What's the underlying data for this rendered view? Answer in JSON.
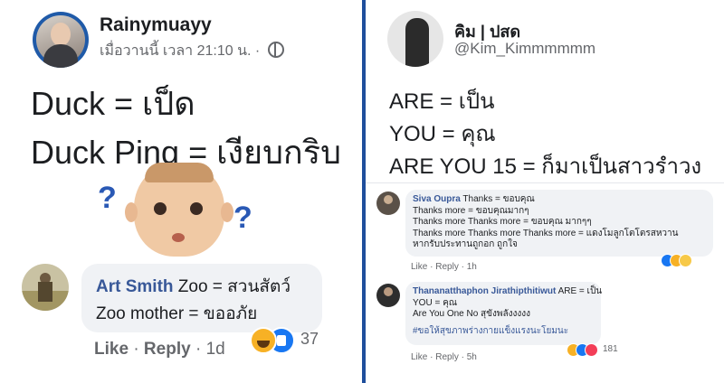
{
  "left_post": {
    "author": "Rainymuayy",
    "time": "เมื่อวานนี้ เวลา 21:10 น. ·",
    "line1": "Duck = เป็ด",
    "line2": "Duck Ping = เงียบกริบ",
    "question_mark": "?",
    "comment": {
      "name": "Art Smith",
      "text1": "Zoo = สวนสัตว์",
      "text2": "Zoo mother = ขออภัย",
      "like": "Like",
      "reply": "Reply",
      "age": "1d",
      "reactions_count": "37"
    }
  },
  "right_post": {
    "author": "คิม | ปสด",
    "handle": "@Kim_Kimmmmmm",
    "line1": "ARE = เป็น",
    "line2": "YOU = คุณ",
    "line3": "ARE YOU 15 = ก็มาเป็นสาวรำวง",
    "comments": [
      {
        "name": "Siva Oupra",
        "lines": [
          "Thanks = ขอบคุณ",
          "Thanks more = ขอบคุณมากๆ",
          "Thanks more Thanks more = ขอบคุณ มากๆๆ",
          "Thanks more Thanks more Thanks more = แดงโมลูกโตโตรสหวาน",
          "หากรับประทานถูกอก ถูกใจ"
        ],
        "like": "Like",
        "reply": "Reply",
        "age": "1h",
        "reactions_count": ""
      },
      {
        "name": "Thananatthaphon Jirathipthitiwut",
        "lines": [
          "ARE = เป็น",
          "YOU = คุณ",
          "Are You One No สุขังพลังงงงง"
        ],
        "hashtag": "#ขอให้สุขภาพร่างกายแข็งแรงนะโยมนะ",
        "like": "Like",
        "reply": "Reply",
        "age": "5h",
        "reactions_count": "181"
      }
    ]
  },
  "colors": {
    "divider": "#1f4e9c",
    "link": "#385898",
    "like_blue": "#1877f2",
    "haha_yellow": "#f7b125",
    "love_red": "#f33e58"
  },
  "icons": [
    "globe-icon",
    "haha-icon",
    "like-icon",
    "love-icon",
    "sad-icon",
    "question-mark-icon"
  ]
}
